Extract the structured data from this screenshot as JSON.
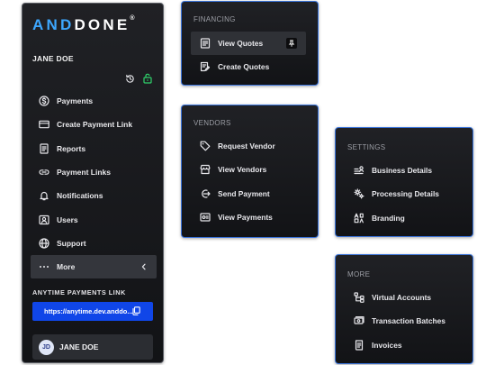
{
  "brand": {
    "logo_part1": "AND",
    "logo_part2": "DONE",
    "logo_mark": "®"
  },
  "sidebar": {
    "user_name": "JANE DOE",
    "items": [
      {
        "label": "Payments",
        "icon": "dollar-circle-icon"
      },
      {
        "label": "Create Payment Link",
        "icon": "credit-card-icon"
      },
      {
        "label": "Reports",
        "icon": "document-icon"
      },
      {
        "label": "Payment Links",
        "icon": "link-icon"
      },
      {
        "label": "Notifications",
        "icon": "bell-icon"
      },
      {
        "label": "Users",
        "icon": "user-icon"
      },
      {
        "label": "Support",
        "icon": "globe-icon"
      },
      {
        "label": "More",
        "icon": "more-dots-icon",
        "active": true
      }
    ],
    "anytime_label": "ANYTIME PAYMENTS LINK",
    "anytime_link": "https://anytime.dev.anddo...",
    "profile": {
      "initials": "JD",
      "name": "JANE DOE"
    }
  },
  "panels": {
    "financing": {
      "title": "FINANCING",
      "items": [
        "View Quotes",
        "Create Quotes"
      ]
    },
    "vendors": {
      "title": "VENDORS",
      "items": [
        "Request Vendor",
        "View Vendors",
        "Send Payment",
        "View Payments"
      ]
    },
    "settings": {
      "title": "SETTINGS",
      "items": [
        "Business Details",
        "Processing Details",
        "Branding"
      ]
    },
    "more": {
      "title": "MORE",
      "items": [
        "Virtual Accounts",
        "Transaction Batches",
        "Invoices"
      ]
    }
  },
  "colors": {
    "accent_blue": "#1046e8",
    "logo_blue": "#3da7ff",
    "unlock_green": "#2fd16b",
    "panel_border": "#3a73d9"
  }
}
